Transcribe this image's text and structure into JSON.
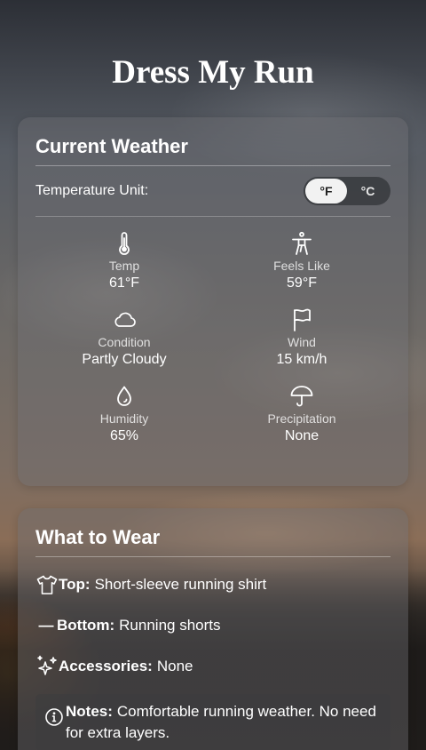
{
  "app": {
    "title": "Dress My Run"
  },
  "weather": {
    "title": "Current Weather",
    "unit_label": "Temperature Unit:",
    "units": {
      "selected": "°F",
      "options": [
        "°F",
        "°C"
      ]
    },
    "stats": [
      {
        "icon": "thermometer-icon",
        "label": "Temp",
        "value": "61°F"
      },
      {
        "icon": "person-icon",
        "label": "Feels Like",
        "value": "59°F"
      },
      {
        "icon": "cloud-icon",
        "label": "Condition",
        "value": "Partly Cloudy"
      },
      {
        "icon": "flag-icon",
        "label": "Wind",
        "value": "15 km/h"
      },
      {
        "icon": "droplet-icon",
        "label": "Humidity",
        "value": "65%"
      },
      {
        "icon": "umbrella-icon",
        "label": "Precipitation",
        "value": "None"
      }
    ]
  },
  "wear": {
    "title": "What to Wear",
    "items": [
      {
        "icon": "shirt-icon",
        "label": "Top:",
        "value": "Short-sleeve running shirt"
      },
      {
        "icon": "dash-icon",
        "label": "Bottom:",
        "value": "Running shorts"
      },
      {
        "icon": "sparkles-icon",
        "label": "Accessories:",
        "value": "None"
      }
    ],
    "notes": {
      "icon": "info-icon",
      "label": "Notes:",
      "value": "Comfortable running weather. No need for extra layers."
    }
  }
}
